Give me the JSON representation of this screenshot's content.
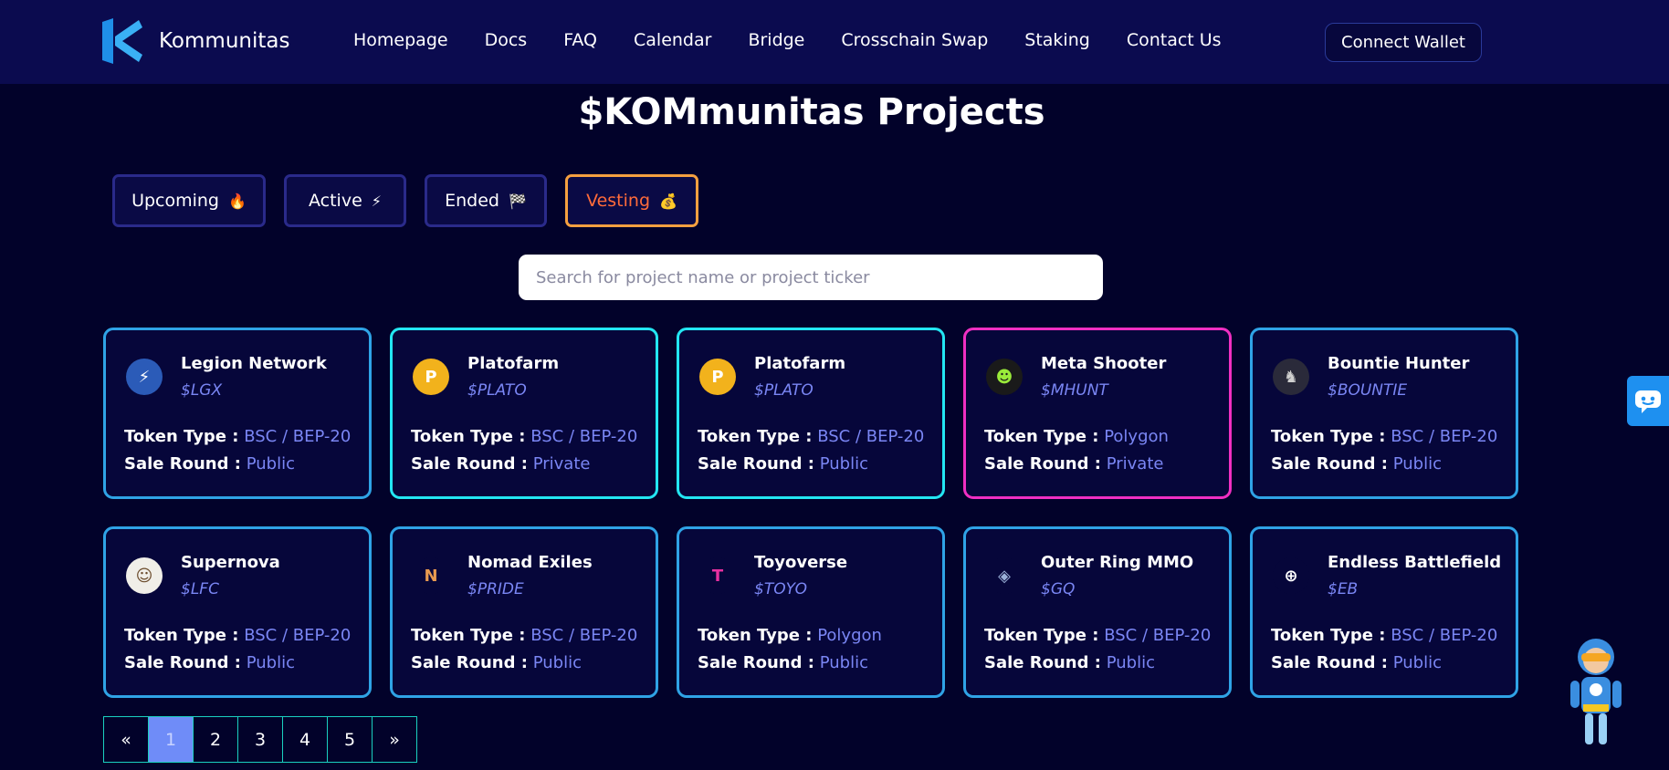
{
  "header": {
    "brand": "Kommunitas",
    "nav": [
      "Homepage",
      "Docs",
      "FAQ",
      "Calendar",
      "Bridge",
      "Crosschain Swap",
      "Staking",
      "Contact Us"
    ],
    "connect_label": "Connect Wallet"
  },
  "main": {
    "title": "$KOMmunitas Projects",
    "tabs": [
      {
        "label": "Upcoming",
        "emoji": "🔥"
      },
      {
        "label": "Active",
        "emoji": "⚡"
      },
      {
        "label": "Ended",
        "emoji": "🏁"
      },
      {
        "label": "Vesting",
        "emoji": "💰"
      }
    ],
    "search_placeholder": "Search for project name or project ticker",
    "token_type_label": "Token Type :",
    "sale_round_label": "Sale Round :",
    "projects": [
      {
        "name": "Legion Network",
        "ticker": "$LGX",
        "token_type": "BSC / BEP-20",
        "sale_round": "Public",
        "icon": "legion-logo-icon",
        "icon_color": "#2b5bb8"
      },
      {
        "name": "Platofarm",
        "ticker": "$PLATO",
        "token_type": "BSC / BEP-20",
        "sale_round": "Private",
        "icon": "platofarm-coin-icon",
        "icon_color": "#f2b21c"
      },
      {
        "name": "Platofarm",
        "ticker": "$PLATO",
        "token_type": "BSC / BEP-20",
        "sale_round": "Public",
        "icon": "platofarm-coin-icon",
        "icon_color": "#f2b21c"
      },
      {
        "name": "Meta Shooter",
        "ticker": "$MHUNT",
        "token_type": "Polygon",
        "sale_round": "Private",
        "icon": "meta-shooter-logo-icon",
        "icon_color": "#1a1a1a"
      },
      {
        "name": "Bountie Hunter",
        "ticker": "$BOUNTIE",
        "token_type": "BSC / BEP-20",
        "sale_round": "Public",
        "icon": "bountie-hunter-logo-icon",
        "icon_color": "#2a2a3a"
      },
      {
        "name": "Supernova",
        "ticker": "$LFC",
        "token_type": "BSC / BEP-20",
        "sale_round": "Public",
        "icon": "supernova-logo-icon",
        "icon_color": "#f0eee8"
      },
      {
        "name": "Nomad Exiles",
        "ticker": "$PRIDE",
        "token_type": "BSC / BEP-20",
        "sale_round": "Public",
        "icon": "nomad-exiles-logo-icon",
        "icon_color": "#06063a"
      },
      {
        "name": "Toyoverse",
        "ticker": "$TOYO",
        "token_type": "Polygon",
        "sale_round": "Public",
        "icon": "toyoverse-logo-icon",
        "icon_color": "#06063a"
      },
      {
        "name": "Outer Ring MMO",
        "ticker": "$GQ",
        "token_type": "BSC / BEP-20",
        "sale_round": "Public",
        "icon": "outer-ring-logo-icon",
        "icon_color": "#06063a"
      },
      {
        "name": "Endless Battlefield",
        "ticker": "$EB",
        "token_type": "BSC / BEP-20",
        "sale_round": "Public",
        "icon": "endless-battlefield-logo-icon",
        "icon_color": "#06063a"
      }
    ],
    "card_borders": [
      "blue",
      "cyan",
      "cyan",
      "pink",
      "blue",
      "blue",
      "blue",
      "blue",
      "blue",
      "blue"
    ]
  },
  "pagination": {
    "prev": "«",
    "pages": [
      "1",
      "2",
      "3",
      "4",
      "5"
    ],
    "current": "1",
    "next": "»"
  },
  "colors": {
    "background": "#02022a",
    "header": "#0b0b4f",
    "accent_value": "#7a86f4",
    "vesting_tab": "#ff6b3a",
    "card_border_blue": "#2fa3e6",
    "card_border_cyan": "#23e6f2",
    "card_border_pink": "#f02fc2"
  },
  "widgets": {
    "chat_icon": "chat-bubble-icon",
    "mascot": "mascot-character-icon"
  }
}
